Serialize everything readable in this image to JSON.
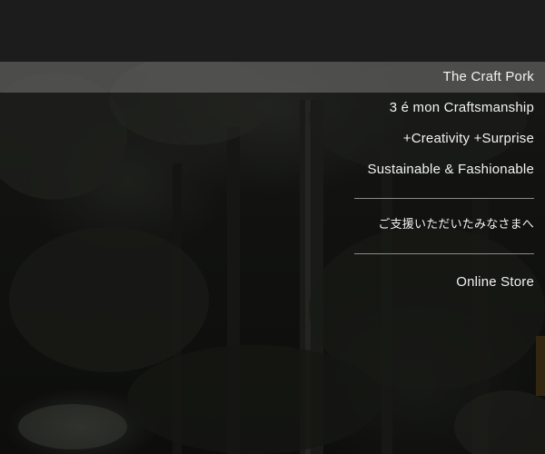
{
  "menu": {
    "items": [
      {
        "label": "The Craft Pork"
      },
      {
        "label": "3 é mon Craftsmanship"
      },
      {
        "label": "+Creativity +Surprise"
      },
      {
        "label": "Sustainable & Fashionable"
      }
    ],
    "support_label": "ご支援いただいたみなさまへ",
    "store_label": "Online Store"
  }
}
